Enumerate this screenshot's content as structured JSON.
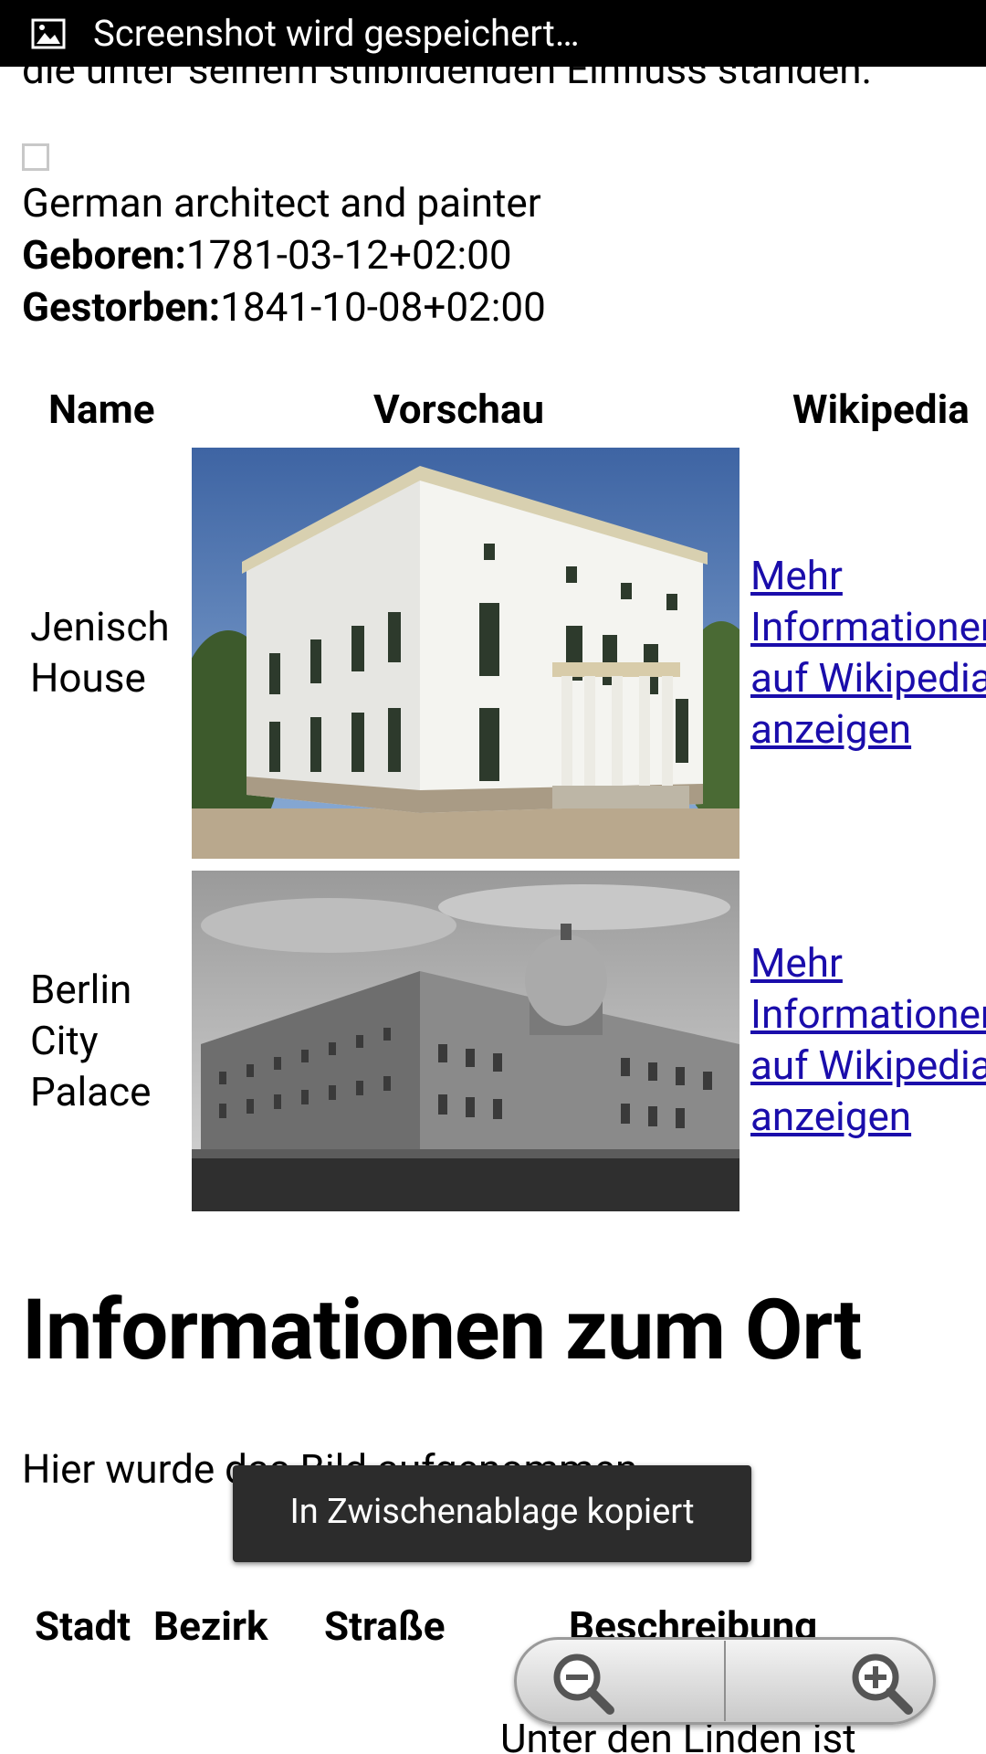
{
  "status_bar": {
    "notification": "Screenshot wird gespeichert…"
  },
  "article": {
    "cutoff_text": "die unter seinem stilbildenden Einfluss standen.",
    "person_description": "German architect and painter",
    "born_label": "Geboren:",
    "born_value": "1781-03-12+02:00",
    "died_label": "Gestorben:",
    "died_value": "1841-10-08+02:00"
  },
  "works_table": {
    "headers": [
      "Name",
      "Vorschau",
      "Wikipedia"
    ],
    "rows": [
      {
        "name_line1": "Jenisch",
        "name_line2": "House",
        "name_line3": "",
        "link_lines": [
          "Mehr",
          "Informationen",
          "auf Wikipedia",
          "anzeigen"
        ]
      },
      {
        "name_line1": "Berlin",
        "name_line2": "City",
        "name_line3": "Palace",
        "link_lines": [
          "Mehr",
          "Informationen",
          "auf Wikipedia",
          "anzeigen"
        ]
      }
    ]
  },
  "location_section": {
    "heading": "Informationen zum Ort",
    "intro": "Hier wurde das Bild aufgenommen.",
    "headers": [
      "Stadt",
      "Bezirk",
      "Straße",
      "Beschreibung"
    ],
    "partial_text": "Unter den Linden ist"
  },
  "toast": {
    "message": "In Zwischenablage kopiert"
  },
  "zoom_controls": {
    "zoom_out_icon": "zoom-out-icon",
    "zoom_in_icon": "zoom-in-icon"
  },
  "colors": {
    "link": "#1a0dab",
    "status_bar": "#000000",
    "toast": "#2c2c2c"
  }
}
